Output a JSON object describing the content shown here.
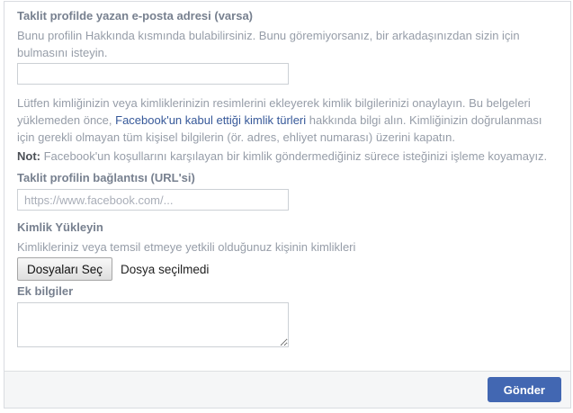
{
  "form": {
    "email_field": {
      "label": "Taklit profilde yazan e-posta adresi (varsa)",
      "help": "Bunu profilin Hakkında kısmında bulabilirsiniz. Bunu göremiyorsanız, bir arkadaşınızdan sizin için bulmasını isteyin.",
      "value": "",
      "placeholder": ""
    },
    "id_instructions": {
      "text_before_link": "Lütfen kimliğinizin veya kimliklerinizin resimlerini ekleyerek kimlik bilgilerinizi onaylayın. Bu belgeleri yüklemeden önce, ",
      "link_label": "Facebook'un kabul ettiği kimlik türleri",
      "text_after_link": " hakkında bilgi alın. Kimliğinizin doğrulanması için gerekli olmayan tüm kişisel bilgilerin (ör. adres, ehliyet numarası) üzerini kapatın."
    },
    "note": {
      "prefix": "Not:",
      "text": " Facebook'un koşullarını karşılayan bir kimlik göndermediğiniz sürece isteğinizi işleme koyamayız."
    },
    "profile_url_field": {
      "label": "Taklit profilin bağlantısı (URL'si)",
      "value": "",
      "placeholder": "https://www.facebook.com/..."
    },
    "id_upload": {
      "label": "Kimlik Yükleyin",
      "help": "Kimlikleriniz veya temsil etmeye yetkili olduğunuz kişinin kimlikleri",
      "choose_files_label": "Dosyaları Seç",
      "no_file_text": "Dosya seçilmedi"
    },
    "extra_info_field": {
      "label": "Ek bilgiler",
      "value": ""
    },
    "footer": {
      "submit_label": "Gönder"
    }
  },
  "colors": {
    "accent_blue": "#4267b2",
    "link_blue": "#365899",
    "label_gray": "#77808f",
    "body_gray": "#969da8",
    "note_dark": "#4b4f56",
    "footer_bg": "#f5f6f7",
    "card_border": "#d9dce1"
  }
}
